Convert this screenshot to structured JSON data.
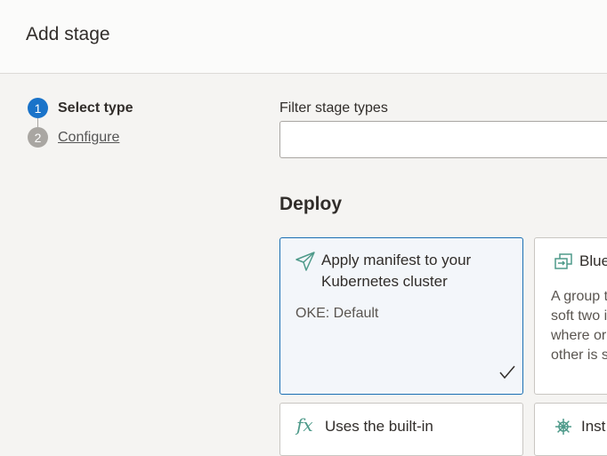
{
  "header": {
    "title": "Add stage"
  },
  "steps": [
    {
      "number": "1",
      "label": "Select type"
    },
    {
      "number": "2",
      "label": "Configure"
    }
  ],
  "filter": {
    "label": "Filter stage types",
    "value": "",
    "placeholder": ""
  },
  "section": {
    "title": "Deploy"
  },
  "cards": [
    {
      "title": "Apply manifest to your Kubernetes cluster",
      "desc": "OKE: Default",
      "selected": true,
      "icon": "paper-plane-icon"
    },
    {
      "title": "Blue",
      "desc": "A group trate soft two iden where or other is s",
      "selected": false,
      "icon": "swap-icon"
    },
    {
      "title": "Uses the built-in",
      "selected": false,
      "icon": "function-icon",
      "glyph": "fx"
    },
    {
      "title": "Inst",
      "selected": false,
      "icon": "helm-wheel-icon"
    }
  ],
  "colors": {
    "accent": "#1a73c9",
    "selected_border": "#1a6fb3",
    "icon_teal": "#4e9a8a"
  }
}
